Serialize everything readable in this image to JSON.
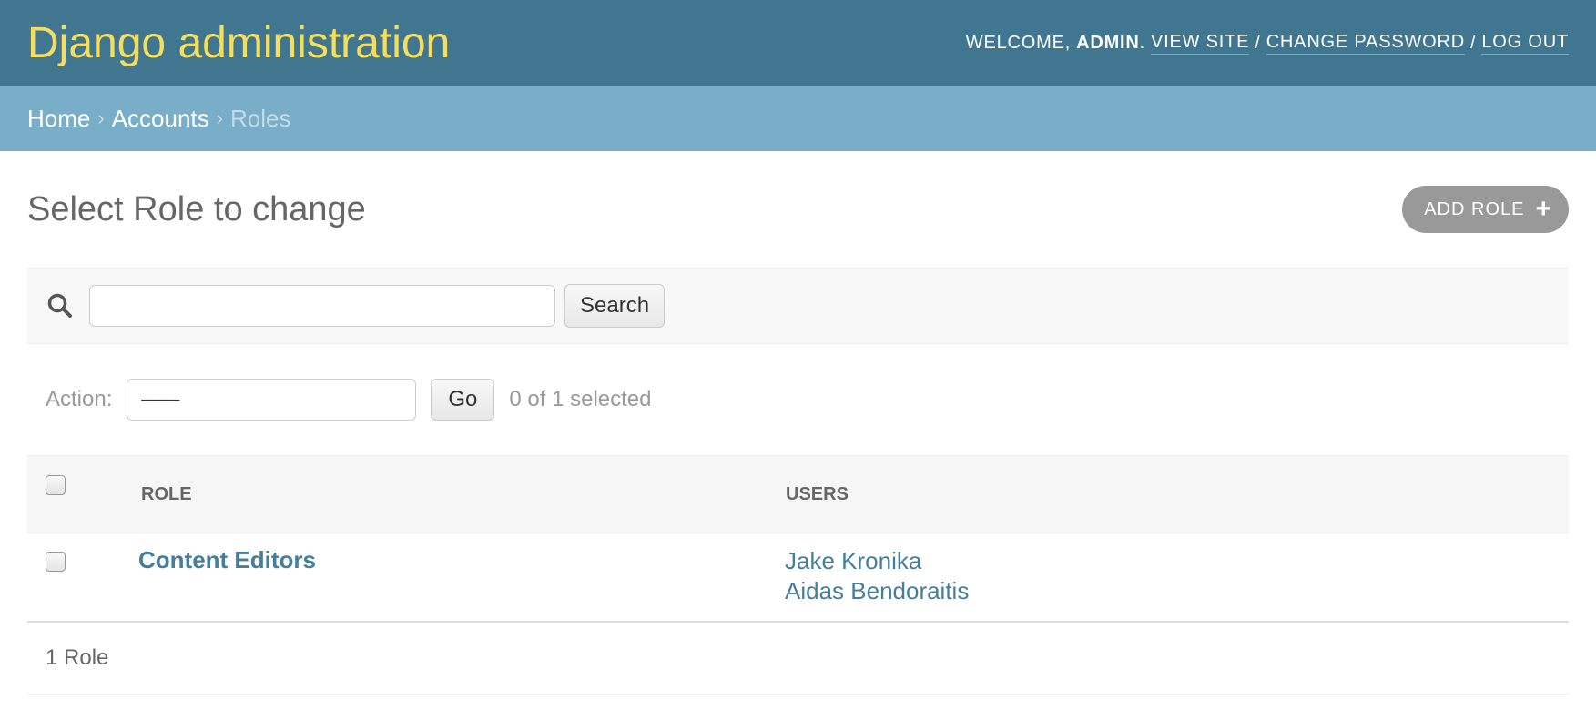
{
  "header": {
    "branding": "Django administration",
    "welcome_prefix": "WELCOME,",
    "username": "ADMIN",
    "username_suffix": ".",
    "view_site": "VIEW SITE",
    "change_password": "CHANGE PASSWORD",
    "log_out": "LOG OUT",
    "separator": "/"
  },
  "breadcrumbs": {
    "home": "Home",
    "accounts": "Accounts",
    "current": "Roles",
    "separator": "›"
  },
  "page": {
    "title": "Select Role to change",
    "add_button": "ADD ROLE",
    "add_icon": "+"
  },
  "search": {
    "value": "",
    "button": "Search",
    "icon": "search-icon"
  },
  "actions": {
    "label": "Action:",
    "selected_option": "---------",
    "go_button": "Go",
    "counter": "0 of 1 selected"
  },
  "table": {
    "columns": [
      "ROLE",
      "USERS"
    ],
    "rows": [
      {
        "role": "Content Editors",
        "users": [
          "Jake Kronika",
          "Aidas Bendoraitis"
        ]
      }
    ]
  },
  "paginator": {
    "text": "1 Role"
  },
  "colors": {
    "header_bg": "#417690",
    "branding": "#f5dd5d",
    "breadcrumbs_bg": "#79aec8",
    "link": "#447e9b",
    "add_button_bg": "#999999"
  }
}
